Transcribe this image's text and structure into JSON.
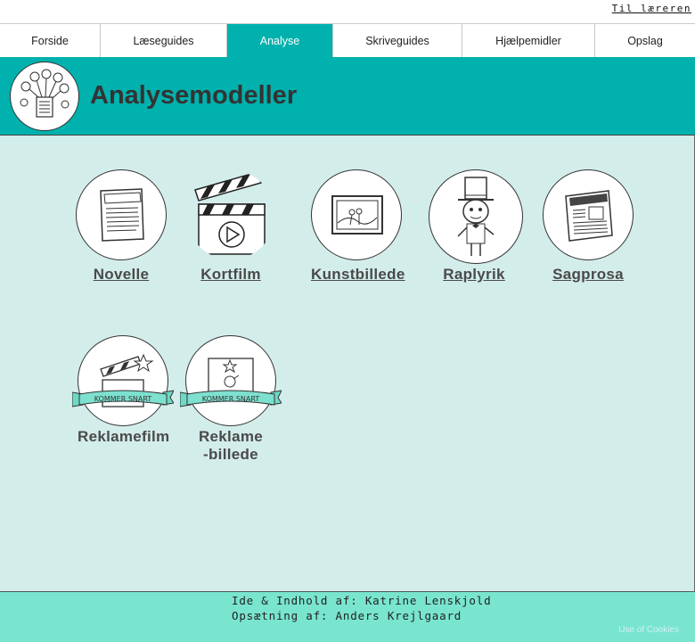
{
  "header": {
    "teacher_link": "Til læreren"
  },
  "nav": {
    "tabs": [
      {
        "label": "Forside"
      },
      {
        "label": "Læseguides"
      },
      {
        "label": "Analyse"
      },
      {
        "label": "Skriveguides"
      },
      {
        "label": "Hjælpemidler"
      },
      {
        "label": "Opslag"
      }
    ],
    "active_tab": "Analyse"
  },
  "banner": {
    "title": "Analysemodeller"
  },
  "tiles": [
    {
      "label": "Novelle",
      "icon": "novelle-book-icon",
      "linked": true
    },
    {
      "label": "Kortfilm",
      "icon": "clapperboard-icon",
      "linked": true
    },
    {
      "label": "Kunstbillede",
      "icon": "framed-painting-icon",
      "linked": true
    },
    {
      "label": "Raplyrik",
      "icon": "top-hat-character-icon",
      "linked": true
    },
    {
      "label": "Sagprosa",
      "icon": "newspaper-icon",
      "linked": true
    },
    {
      "label": "Reklamefilm",
      "icon": "clapperboard-coming-soon-icon",
      "linked": false,
      "ribbon": "KOMMER SNART"
    },
    {
      "label_line1": "Reklame",
      "label_line2": "-billede",
      "icon": "picture-coming-soon-icon",
      "linked": false,
      "ribbon": "KOMMER SNART"
    }
  ],
  "footer": {
    "line1": "Ide & Indhold af: Katrine Lenskjold",
    "line2": "Opsætning af: Anders Krejlgaard",
    "cookies": "Use of Cookies"
  },
  "colors": {
    "accent": "#00b1ad",
    "content_bg": "#d3edeb",
    "footer_bg": "#79e5cf",
    "ribbon": "#7ee0cf"
  }
}
